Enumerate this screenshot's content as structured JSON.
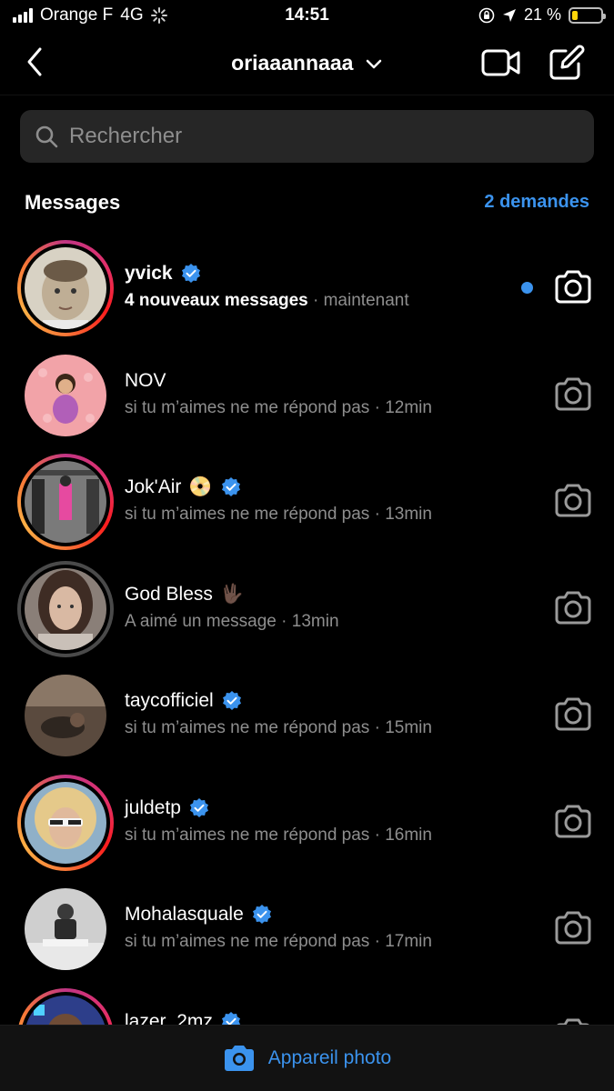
{
  "status_bar": {
    "carrier": "Orange F",
    "network": "4G",
    "time": "14:51",
    "battery_percent": "21 %",
    "battery_level": 0.21
  },
  "nav": {
    "username": "oriaaannaaa"
  },
  "search": {
    "placeholder": "Rechercher"
  },
  "section": {
    "title": "Messages",
    "requests": "2 demandes"
  },
  "conversations": [
    {
      "name": "yvick",
      "verified": true,
      "emoji": "",
      "message": "4 nouveaux messages",
      "time": "maintenant",
      "unread": true,
      "ring": "story"
    },
    {
      "name": "NOV",
      "verified": false,
      "emoji": "",
      "message": "si tu m’aimes ne me répond pas",
      "time": "12min",
      "unread": false,
      "ring": "none"
    },
    {
      "name": "Jok'Air",
      "verified": true,
      "emoji": "📀",
      "message": "si tu m’aimes ne me répond pas",
      "time": "13min",
      "unread": false,
      "ring": "story"
    },
    {
      "name": "God Bless",
      "verified": false,
      "emoji": "🖖🏿",
      "message": "A aimé un message",
      "time": "13min",
      "unread": false,
      "ring": "seen"
    },
    {
      "name": "taycofficiel",
      "verified": true,
      "emoji": "",
      "message": "si tu m’aimes ne me répond pas",
      "time": "15min",
      "unread": false,
      "ring": "none"
    },
    {
      "name": "juldetp",
      "verified": true,
      "emoji": "",
      "message": "si tu m’aimes ne me répond pas",
      "time": "16min",
      "unread": false,
      "ring": "story"
    },
    {
      "name": "Mohalasquale",
      "verified": true,
      "emoji": "",
      "message": "si tu m’aimes ne me répond pas",
      "time": "17min",
      "unread": false,
      "ring": "none"
    },
    {
      "name": "lazer_2mz",
      "verified": true,
      "emoji": "",
      "message": "",
      "time": "",
      "unread": false,
      "ring": "story"
    }
  ],
  "bottom_bar": {
    "label": "Appareil photo"
  },
  "colors": {
    "accent": "#3b93ee",
    "background": "#000000",
    "secondary_text": "#8e8e8e",
    "search_bg": "#262626"
  },
  "icons": [
    "back-chevron-icon",
    "chevron-down-icon",
    "video-call-icon",
    "compose-icon",
    "search-icon",
    "verified-badge-icon",
    "camera-icon"
  ]
}
